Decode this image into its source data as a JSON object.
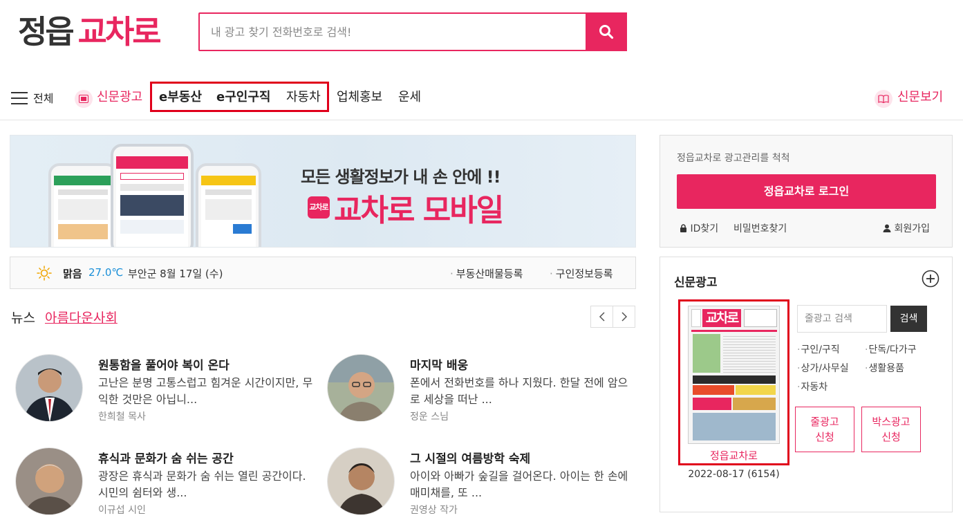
{
  "header": {
    "logo_part1": "정읍",
    "logo_part2": "교차로",
    "search_placeholder": "내 광고 찾기 전화번호로 검색!"
  },
  "nav": {
    "all_label": "전체",
    "newspaper_ad": "신문광고",
    "e_realestate": "e부동산",
    "e_jobs": "e구인구직",
    "car": "자동차",
    "business_promo": "업체홍보",
    "fortune": "운세",
    "view_newspaper": "신문보기"
  },
  "banner": {
    "tagline": "모든 생활정보가 내 손 안에 !!",
    "title": "교차로 모바일",
    "badge": "교차로"
  },
  "weather": {
    "condition": "맑음",
    "temperature": "27.0℃",
    "location_date": "부안군 8월 17일 (수)",
    "link_realestate": "부동산매물등록",
    "link_jobs": "구인정보등록"
  },
  "news": {
    "label": "뉴스",
    "category": "아름다운사회",
    "items": [
      {
        "title": "원통함을 풀어야 복이 온다",
        "body": "고난은 분명 고통스럽고 힘겨운 시간이지만, 무익한 것만은 아닙니...",
        "author": "한희철 목사"
      },
      {
        "title": "마지막 배웅",
        "body": "폰에서 전화번호를 하나 지웠다. 한달 전에 암으로 세상을 떠난 ...",
        "author": "정운 스님"
      },
      {
        "title": "휴식과 문화가 숨 쉬는 공간",
        "body": "광장은 휴식과 문화가 숨 쉬는 열린 공간이다. 시민의 쉼터와 생...",
        "author": "이규섭 시인"
      },
      {
        "title": "그 시절의 여름방학 숙제",
        "body": "아이와 아빠가 숲길을 걸어온다. 아이는 한 손에 매미채를, 또 ...",
        "author": "권영상 작가"
      }
    ]
  },
  "login": {
    "description": "정읍교차로 광고관리를 척척",
    "login_button": "정읍교차로 로그인",
    "find_id": "ID찾기",
    "find_password": "비밀번호찾기",
    "signup": "회원가입"
  },
  "newspaper": {
    "heading": "신문광고",
    "thumb_label": "정읍교차로",
    "thumb_date": "2022-08-17 (6154)",
    "thumb_masthead": "교차로",
    "search_placeholder": "줄광고 검색",
    "search_button": "검색",
    "categories": [
      "구인/구직",
      "단독/다가구",
      "상가/사무실",
      "생활용품",
      "자동차"
    ],
    "apply_line_1": "줄광고",
    "apply_line_2": "신청",
    "apply_box_1": "박스광고",
    "apply_box_2": "신청"
  },
  "colors": {
    "accent": "#e8265f",
    "highlight_border": "#e0001b",
    "temperature": "#1a8fd8"
  }
}
